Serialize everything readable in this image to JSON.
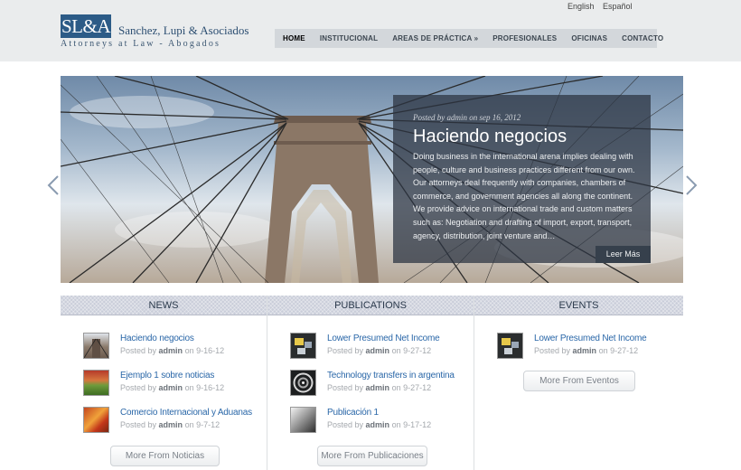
{
  "header": {
    "logo": "SL&A",
    "firm_name": "Sanchez, Lupi & Asociados",
    "tagline": "Attorneys at Law - Abogados",
    "languages": [
      "English",
      "Español"
    ]
  },
  "nav": {
    "items": [
      "HOME",
      "INSTITUCIONAL",
      "AREAS DE PRÁCTICA »",
      "PROFESIONALES",
      "OFICINAS",
      "CONTACTO"
    ]
  },
  "slider": {
    "meta": "Posted by admin on sep 16, 2012",
    "title": "Haciendo negocios",
    "body": "Doing business in the international arena implies dealing with people, culture and business practices different from our own. Our attorneys deal frequently with companies, chambers of commerce, and government agencies all along the continent. We provide advice on international trade and custom matters such as: Negotiation and drafting of import, export, transport, agency, distribution, joint venture and…",
    "read_more": "Leer Más"
  },
  "columns": {
    "news": {
      "title": "NEWS",
      "items": [
        {
          "title": "Haciendo negocios",
          "posted": "Posted by",
          "author": "admin",
          "on": "on 9-16-12"
        },
        {
          "title": "Ejemplo 1 sobre noticias",
          "posted": "Posted by",
          "author": "admin",
          "on": "on 9-16-12"
        },
        {
          "title": "Comercio Internacional y Aduanas",
          "posted": "Posted by",
          "author": "admin",
          "on": "on 9-7-12"
        }
      ],
      "more": "More From Noticias"
    },
    "publications": {
      "title": "PUBLICATIONS",
      "items": [
        {
          "title": "Lower Presumed Net Income",
          "posted": "Posted by",
          "author": "admin",
          "on": "on 9-27-12"
        },
        {
          "title": "Technology transfers in argentina",
          "posted": "Posted by",
          "author": "admin",
          "on": "on 9-27-12"
        },
        {
          "title": "Publicación 1",
          "posted": "Posted by",
          "author": "admin",
          "on": "on 9-17-12"
        }
      ],
      "more": "More From Publicaciones"
    },
    "events": {
      "title": "EVENTS",
      "items": [
        {
          "title": "Lower Presumed Net Income",
          "posted": "Posted by",
          "author": "admin",
          "on": "on 9-27-12"
        }
      ],
      "more": "More From Eventos"
    }
  },
  "colors": {
    "brand": "#2c5b87",
    "link": "#2a67a8",
    "nav_bg": "#d3d7db",
    "header_bg": "#eaeced"
  },
  "icons": [
    "chevron-left-icon",
    "chevron-right-icon"
  ]
}
